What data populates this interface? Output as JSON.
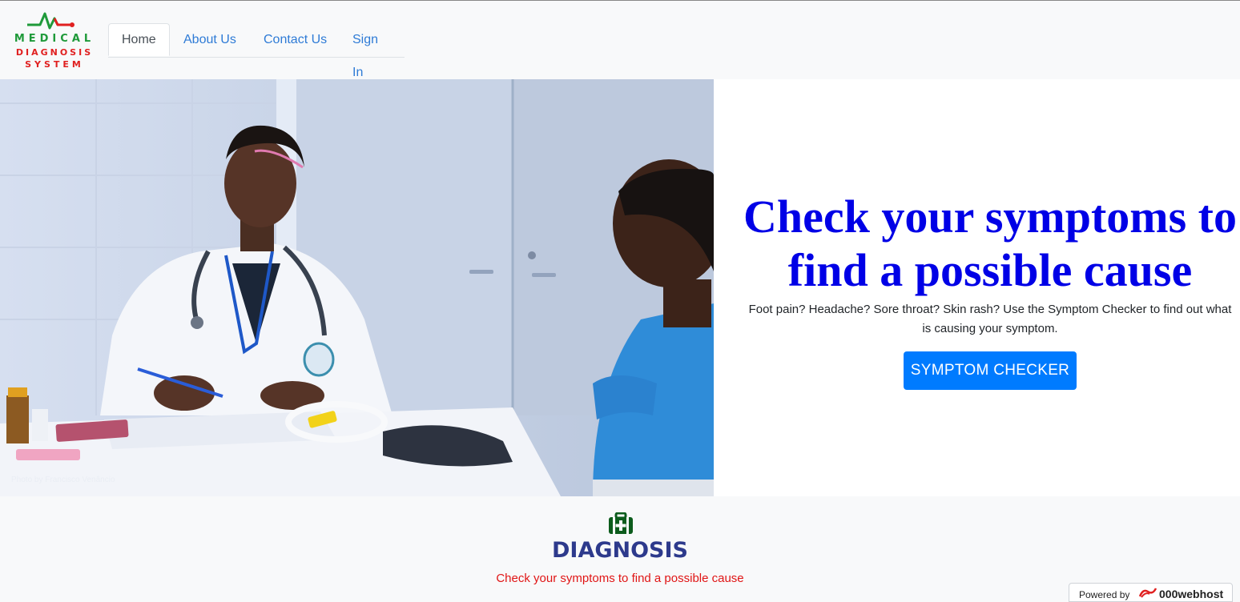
{
  "logo": {
    "line1": "MEDICAL",
    "line2": "DIAGNOSIS",
    "line3": "SYSTEM",
    "icon": "heartbeat-icon",
    "colors": {
      "green": "#1f9a3a",
      "red": "#e02020"
    }
  },
  "nav": {
    "items": [
      {
        "label": "Home",
        "active": true
      },
      {
        "label": "About Us",
        "active": false
      },
      {
        "label": "Contact Us",
        "active": false
      },
      {
        "label": "Sign In",
        "active": false
      }
    ]
  },
  "hero": {
    "photo_credit": "Photo by Francisco Venâncio",
    "title": "Check your symptoms to find a possible cause",
    "subtitle": "Foot pain? Headache? Sore throat? Skin rash? Use the Symptom Checker to find out what is causing your symptom.",
    "button_label": "SYMPTOM CHECKER",
    "colors": {
      "title": "#0000e6",
      "button": "#007bff"
    }
  },
  "diagnosis": {
    "icon": "medkit-icon",
    "title": "DIAGNOSIS",
    "subtitle": "Check your symptoms to find a possible cause",
    "colors": {
      "title": "#2d3a8c",
      "subtitle": "#e01515",
      "icon": "#0c5c1c"
    }
  },
  "badge": {
    "powered_by": "Powered by",
    "host": "000webhost"
  }
}
